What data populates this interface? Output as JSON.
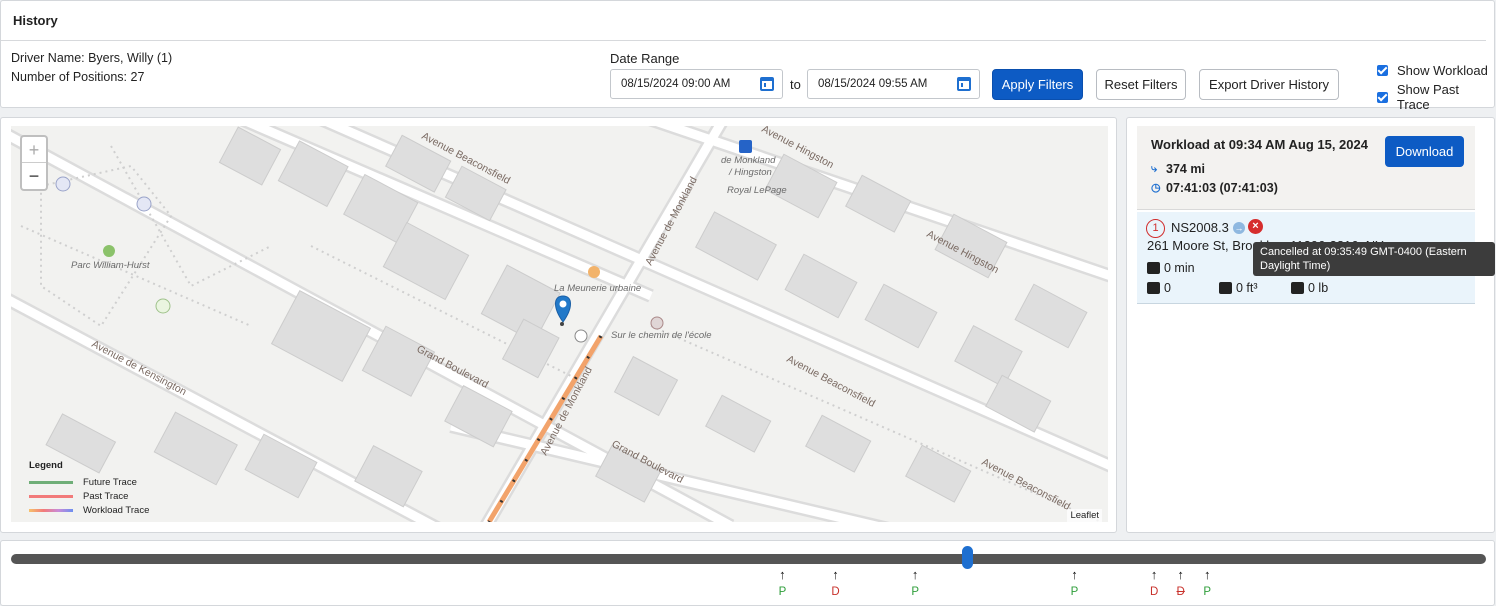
{
  "header": {
    "title": "History",
    "driver_name": "Driver Name: Byers, Willy (1)",
    "num_positions": "Number of Positions: 27",
    "date_range_label": "Date Range",
    "date_from": "08/15/2024 09:00 AM",
    "date_to": "08/15/2024 09:55 AM",
    "to_label": "to",
    "apply_label": "Apply Filters",
    "reset_label": "Reset Filters",
    "export_label": "Export Driver History",
    "show_workload_label": "Show Workload",
    "show_past_trace_label": "Show Past Trace",
    "show_workload_checked": true,
    "show_past_trace_checked": true
  },
  "map": {
    "streets": [
      "Grand Boulevard",
      "Grand Boulevard",
      "Avenue Beaconsfield",
      "Avenue Beaconsfield",
      "Avenue Beaconsfield",
      "Avenue Hingston",
      "Avenue Hingston",
      "Avenue de Monkland",
      "Avenue de Monkland",
      "Avenue de Kensington"
    ],
    "pois": [
      "Parc William-Hurst",
      "La Meunerie urbaine",
      "Sur le chemin de l'école",
      "de Monkland / Hingston",
      "Royal LePage"
    ],
    "zoom_in": "+",
    "zoom_out": "−",
    "legend": {
      "title": "Legend",
      "items": [
        {
          "label": "Future Trace",
          "color": "#6fae78"
        },
        {
          "label": "Past Trace",
          "color": "#f27a7a"
        },
        {
          "label": "Workload Trace",
          "color": "gradient"
        }
      ]
    },
    "attribution": "Leaflet"
  },
  "workload": {
    "title": "Workload at 09:34 AM Aug 15, 2024",
    "distance": "374 mi",
    "duration": "07:41:03 (07:41:03)",
    "download_label": "Download",
    "stop": {
      "number": "1",
      "id": "NS2008.3",
      "address": "261 Moore St, Brooklyn, 11206-3816, NY",
      "service_time": "0 min",
      "pieces": "0",
      "volume": "0 ft³",
      "weight": "0 lb"
    },
    "tooltip": "Cancelled at 09:35:49 GMT-0400 (Eastern Daylight Time)"
  },
  "timeline": {
    "progress": 0.648,
    "markers": [
      {
        "label": "P",
        "color": "#2e9e3a",
        "pos": 0.523
      },
      {
        "label": "D",
        "color": "#c8312b",
        "pos": 0.559
      },
      {
        "label": "P",
        "color": "#2e9e3a",
        "pos": 0.613
      },
      {
        "label": "P",
        "color": "#2e9e3a",
        "pos": 0.721
      },
      {
        "label": "D",
        "color": "#c8312b",
        "pos": 0.775
      },
      {
        "label": "D",
        "color": "#c8312b",
        "pos": 0.793,
        "struck": true
      },
      {
        "label": "P",
        "color": "#2e9e3a",
        "pos": 0.811
      }
    ]
  }
}
